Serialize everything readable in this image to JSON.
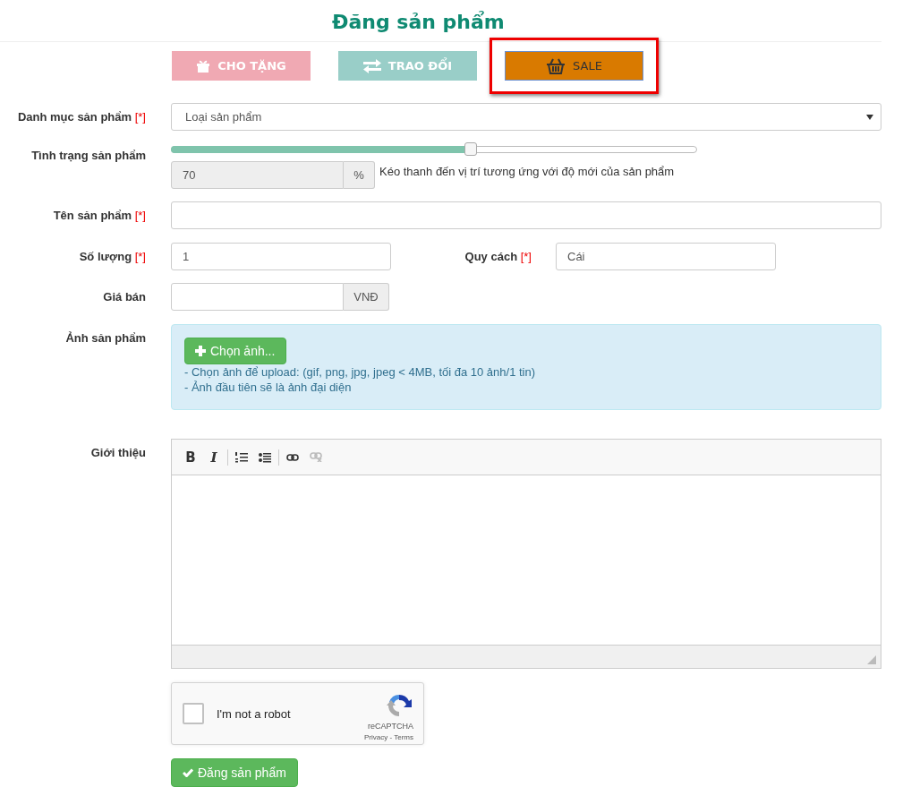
{
  "title": "Đăng sản phẩm",
  "post_types": [
    {
      "kind": "gift",
      "label": "CHO TẶNG",
      "color": "#f0a9b3",
      "selected": false,
      "highlighted": false
    },
    {
      "kind": "swap",
      "label": "TRAO ĐỔI",
      "color": "#99cec8",
      "selected": false,
      "highlighted": false
    },
    {
      "kind": "basket",
      "label": "SALE",
      "color": "#d97a00",
      "selected": true,
      "highlighted": true
    }
  ],
  "form": {
    "category": {
      "label": "Danh mục sản phẩm",
      "required_mark": "[*]",
      "value": "Loại sản phẩm"
    },
    "condition": {
      "label": "Tình trạng sản phẩm",
      "level": 0.57,
      "value": "70",
      "unit": "%",
      "help": "Kéo thanh đến vị trí tương ứng với độ mới của sản phẩm"
    },
    "name": {
      "label": "Tên sản phẩm",
      "required_mark": "[*]"
    },
    "quantity": {
      "label": "Số lượng",
      "required_mark": "[*]",
      "value": "1"
    },
    "unit_spec": {
      "label": "Quy cách",
      "required_mark": "[*]",
      "value": "Cái"
    },
    "price": {
      "label": "Giá bán",
      "unit": "VNĐ"
    },
    "photos": {
      "label": "Ảnh sản phẩm",
      "button": "Chọn ảnh...",
      "notes": [
        "- Chọn ảnh để upload: (gif, png, jpg, jpeg < 4MB, tối đa 10 ảnh/1 tin)",
        "- Ảnh đầu tiên sẽ là ảnh đại diện"
      ]
    },
    "intro": {
      "label": "Giới thiệu",
      "toolbar_groups": [
        {
          "buttons": [
            {
              "kind": "bold",
              "label": "B",
              "disabled": false
            },
            {
              "kind": "italic",
              "label": "I",
              "disabled": false
            }
          ]
        },
        {
          "buttons": [
            {
              "kind": "ordered-list",
              "disabled": false
            },
            {
              "kind": "bullet-list",
              "disabled": false
            }
          ]
        },
        {
          "buttons": [
            {
              "kind": "link",
              "disabled": false
            },
            {
              "kind": "unlink",
              "disabled": true
            }
          ]
        }
      ]
    },
    "captcha": {
      "label": "I'm not a robot",
      "checked": false,
      "brand": "reCAPTCHA",
      "links": "Privacy - Terms"
    },
    "submit": "Đăng sản phẩm"
  }
}
